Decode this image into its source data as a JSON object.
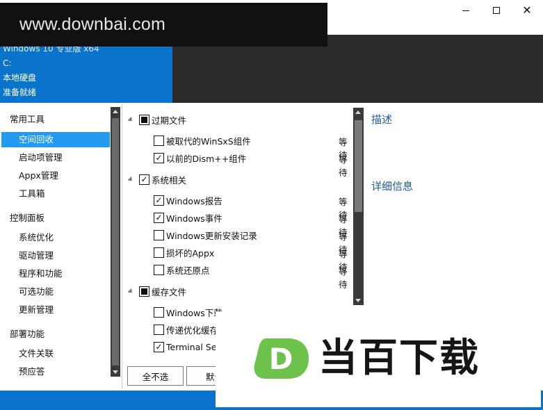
{
  "watermark": {
    "text": "www.downbai.com"
  },
  "window_controls": {
    "minimize": "—",
    "maximize": "□",
    "close": "✕"
  },
  "system_info": {
    "os": "Windows 10 专业版 x64",
    "drive": "C:",
    "disk": "本地硬盘",
    "status": "准备就绪"
  },
  "sidebar": {
    "groups": [
      {
        "label": "常用工具",
        "items": [
          {
            "label": "空间回收",
            "active": true
          },
          {
            "label": "启动项管理"
          },
          {
            "label": "Appx管理"
          },
          {
            "label": "工具箱"
          }
        ]
      },
      {
        "label": "控制面板",
        "items": [
          {
            "label": "系统优化"
          },
          {
            "label": "驱动管理"
          },
          {
            "label": "程序和功能"
          },
          {
            "label": "可选功能"
          },
          {
            "label": "更新管理"
          }
        ]
      },
      {
        "label": "部署功能",
        "items": [
          {
            "label": "文件关联"
          },
          {
            "label": "预应答"
          }
        ]
      }
    ]
  },
  "tree": {
    "categories": [
      {
        "label": "过期文件",
        "state": "partial",
        "items": [
          {
            "label": "被取代的WinSxS组件",
            "checked": false,
            "status": "等待"
          },
          {
            "label": "以前的Dism++组件",
            "checked": true,
            "status": "等待"
          }
        ]
      },
      {
        "label": "系统相关",
        "state": "checked",
        "items": [
          {
            "label": "Windows报告",
            "checked": true,
            "status": "等待"
          },
          {
            "label": "Windows事件",
            "checked": true,
            "status": "等待"
          },
          {
            "label": "Windows更新安装记录",
            "checked": false,
            "status": "等待"
          },
          {
            "label": "损坏的Appx",
            "checked": false,
            "status": "等待"
          },
          {
            "label": "系统还原点",
            "checked": false,
            "status": "等待"
          }
        ]
      },
      {
        "label": "缓存文件",
        "state": "partial",
        "items": [
          {
            "label": "Windows下载",
            "checked": false
          },
          {
            "label": "传递优化缓存",
            "checked": false
          },
          {
            "label": "Terminal Server",
            "checked": true
          }
        ]
      }
    ]
  },
  "buttons": {
    "deselect_all": "全不选",
    "default": "默认"
  },
  "right_pane": {
    "description_title": "描述",
    "details_title": "详细信息"
  },
  "logo": {
    "mark": "D",
    "text": "当百下载",
    "colors": {
      "green": "#6cc24a",
      "dark": "#151515"
    }
  },
  "colors": {
    "accent_blue": "#0a74cc",
    "selection_blue": "#229af0",
    "dark_panel": "#2b2b2b"
  }
}
